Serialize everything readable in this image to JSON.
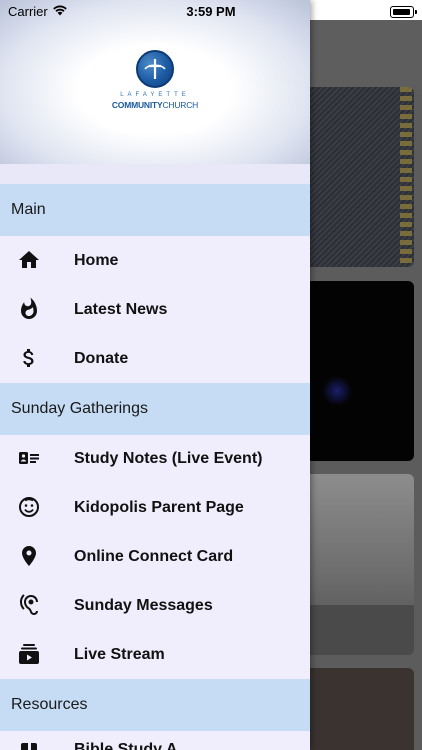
{
  "status_bar": {
    "carrier": "Carrier",
    "time": "3:59 PM"
  },
  "logo": {
    "line1": "LAFAYETTE",
    "line2_bold": "COMMUNITY",
    "line2_regular": "CHURCH",
    "brand_color": "#1b5aa0"
  },
  "menu": {
    "sections": [
      {
        "label": "Main",
        "items": [
          {
            "label": "Home",
            "icon": "home-icon"
          },
          {
            "label": "Latest News",
            "icon": "flame-icon"
          },
          {
            "label": "Donate",
            "icon": "dollar-icon"
          }
        ]
      },
      {
        "label": "Sunday Gatherings",
        "items": [
          {
            "label": "Study Notes (Live Event)",
            "icon": "notes-card-icon"
          },
          {
            "label": "Kidopolis Parent Page",
            "icon": "smiley-icon"
          },
          {
            "label": "Online Connect Card",
            "icon": "location-pin-icon"
          },
          {
            "label": "Sunday Messages",
            "icon": "hearing-icon"
          },
          {
            "label": "Live Stream",
            "icon": "video-library-icon"
          }
        ]
      },
      {
        "label": "Resources",
        "items": [
          {
            "label": "Bible Study A",
            "icon": "book-icon"
          }
        ]
      }
    ]
  },
  "colors": {
    "section_background": "#c5dcf4",
    "drawer_background": "#f0eefc"
  }
}
